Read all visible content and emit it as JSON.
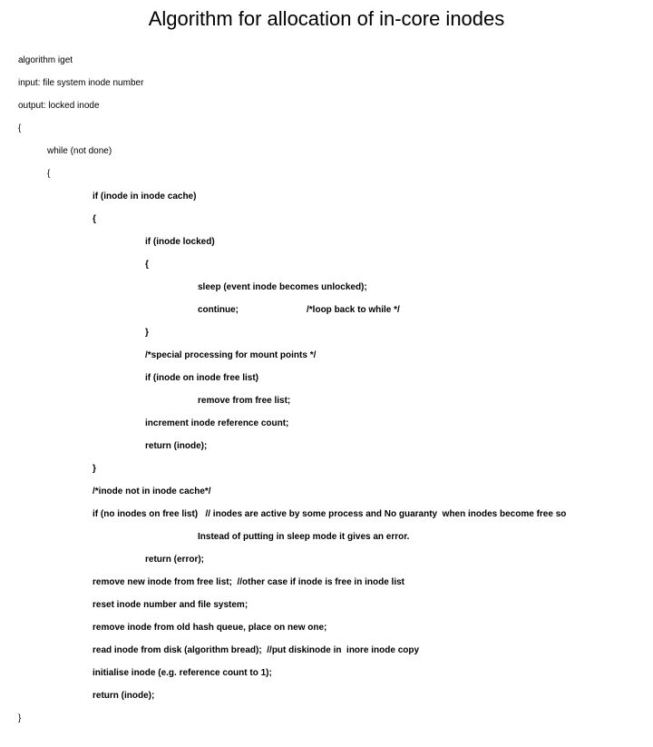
{
  "title": "Algorithm for allocation of in-core inodes",
  "l1": "algorithm iget",
  "l2": "input: file system inode number",
  "l3": "output: locked inode",
  "l4": "{",
  "l5": "while (not done)",
  "l6": "{",
  "l7": "if (inode in inode cache)",
  "l8": "{",
  "l9": "if (inode locked)",
  "l10": "{",
  "l11": "sleep (event inode becomes unlocked);",
  "l12a": "continue;",
  "l12b": "/*loop back to while */",
  "l13": "}",
  "l14": "/*special processing for mount points */",
  "l15": "if (inode on inode free list)",
  "l16": "remove from free list;",
  "l17": "increment inode reference count;",
  "l18": "return (inode);",
  "l19": "}",
  "l20": "/*inode not in inode cache*/",
  "l21a": "if (no inodes on free list)",
  "l21b": "// inodes are active by some process and No guaranty  when inodes become free so",
  "l21c": "Instead of putting in sleep mode it gives an error.",
  "l22": "return (error);",
  "l23a": "remove new inode from free list;",
  "l23b": "//other case if inode is free in inode list",
  "l24": "reset inode number and file system;",
  "l25": "remove inode from old hash queue, place on new one;",
  "l26a": "read inode from disk (algorithm bread);",
  "l26b": "//put diskinode in  inore inode copy",
  "l27": "initialise inode (e.g. reference count to 1);",
  "l28": "return (inode);",
  "l29": "}"
}
